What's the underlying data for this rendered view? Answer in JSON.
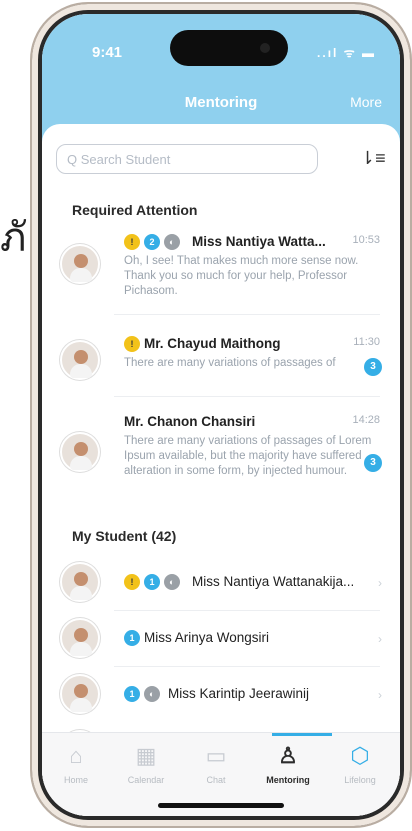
{
  "side_glyph": "ภั",
  "status": {
    "time": "9:41",
    "icons": "..ıl ᯤ ▬"
  },
  "header": {
    "title": "Mentoring",
    "more": "More"
  },
  "search": {
    "placeholder": "Q Search Student"
  },
  "sections": {
    "required": "Required Attention",
    "my_students": "My Student (42)"
  },
  "required_rows": [
    {
      "badges": [
        "!",
        "2",
        "◐"
      ],
      "name": "Miss Nantiya Watta...",
      "time": "10:53",
      "message": "Oh, I see! That makes much more sense now. Thank you so much for your help, Professor Pichasom.",
      "count": ""
    },
    {
      "badges": [
        "!"
      ],
      "name": "Mr. Chayud Maithong",
      "time": "11:30",
      "message": "There are many variations of passages of",
      "count": "3"
    },
    {
      "badges": [],
      "name": "Mr. Chanon Chansiri",
      "time": "14:28",
      "message": "There are many variations of passages of Lorem Ipsum available, but the majority have suffered alteration in some form, by injected humour.",
      "count": "3"
    }
  ],
  "student_rows": [
    {
      "badges": [
        "!",
        "1",
        "◐"
      ],
      "name": "Miss Nantiya Wattanakija..."
    },
    {
      "badges": [
        "1"
      ],
      "name": "Miss Arinya Wongsiri"
    },
    {
      "badges": [
        "1",
        "◐"
      ],
      "name": "Miss Karintip Jeerawinij"
    }
  ],
  "tabbar": {
    "items": [
      {
        "label": "Home",
        "icon": "home-icon"
      },
      {
        "label": "Calendar",
        "icon": "calendar-icon"
      },
      {
        "label": "Chat",
        "icon": "chat-icon"
      },
      {
        "label": "Mentoring",
        "icon": "mentoring-icon"
      },
      {
        "label": "Lifelong",
        "icon": "lifelong-icon"
      }
    ],
    "active": "Mentoring"
  },
  "colors": {
    "accent": "#35aee6",
    "header": "#8fd0ee",
    "warning": "#f2c21a"
  }
}
